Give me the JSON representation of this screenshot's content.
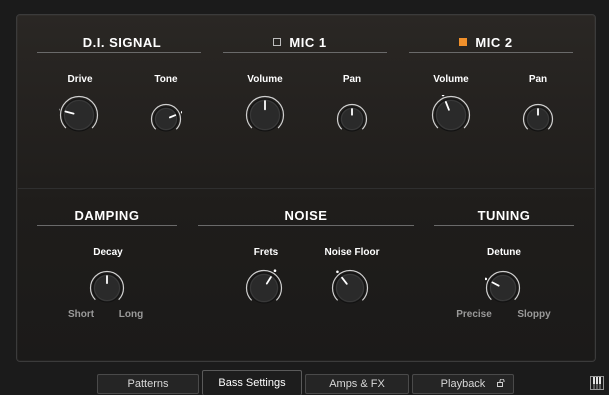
{
  "sections": {
    "di_signal": {
      "title": "D.I. SIGNAL",
      "knobs": [
        {
          "label": "Drive",
          "value": 0.22
        },
        {
          "label": "Tone",
          "value": 0.75
        }
      ]
    },
    "mic1": {
      "title": "MIC 1",
      "enabled": false,
      "knobs": [
        {
          "label": "Volume",
          "value": 0.5
        },
        {
          "label": "Pan",
          "value": 0.5
        }
      ]
    },
    "mic2": {
      "title": "MIC 2",
      "enabled": true,
      "knobs": [
        {
          "label": "Volume",
          "value": 0.42
        },
        {
          "label": "Pan",
          "value": 0.5
        }
      ]
    },
    "damping": {
      "title": "DAMPING",
      "knobs": [
        {
          "label": "Decay",
          "value": 0.5,
          "min_label": "Short",
          "max_label": "Long"
        }
      ]
    },
    "noise": {
      "title": "NOISE",
      "knobs": [
        {
          "label": "Frets",
          "value": 0.62
        },
        {
          "label": "Noise Floor",
          "value": 0.36
        }
      ]
    },
    "tuning": {
      "title": "TUNING",
      "knobs": [
        {
          "label": "Detune",
          "value": 0.27,
          "min_label": "Precise",
          "max_label": "Sloppy"
        }
      ]
    }
  },
  "tabs": [
    {
      "label": "Patterns",
      "active": false
    },
    {
      "label": "Bass Settings",
      "active": true
    },
    {
      "label": "Amps & FX",
      "active": false
    },
    {
      "label": "Playback",
      "active": false,
      "icon": "lock-icon"
    }
  ],
  "colors": {
    "accent": "#f0902b",
    "arc": "#cfcfcf",
    "knob": "#2a2a2a"
  }
}
